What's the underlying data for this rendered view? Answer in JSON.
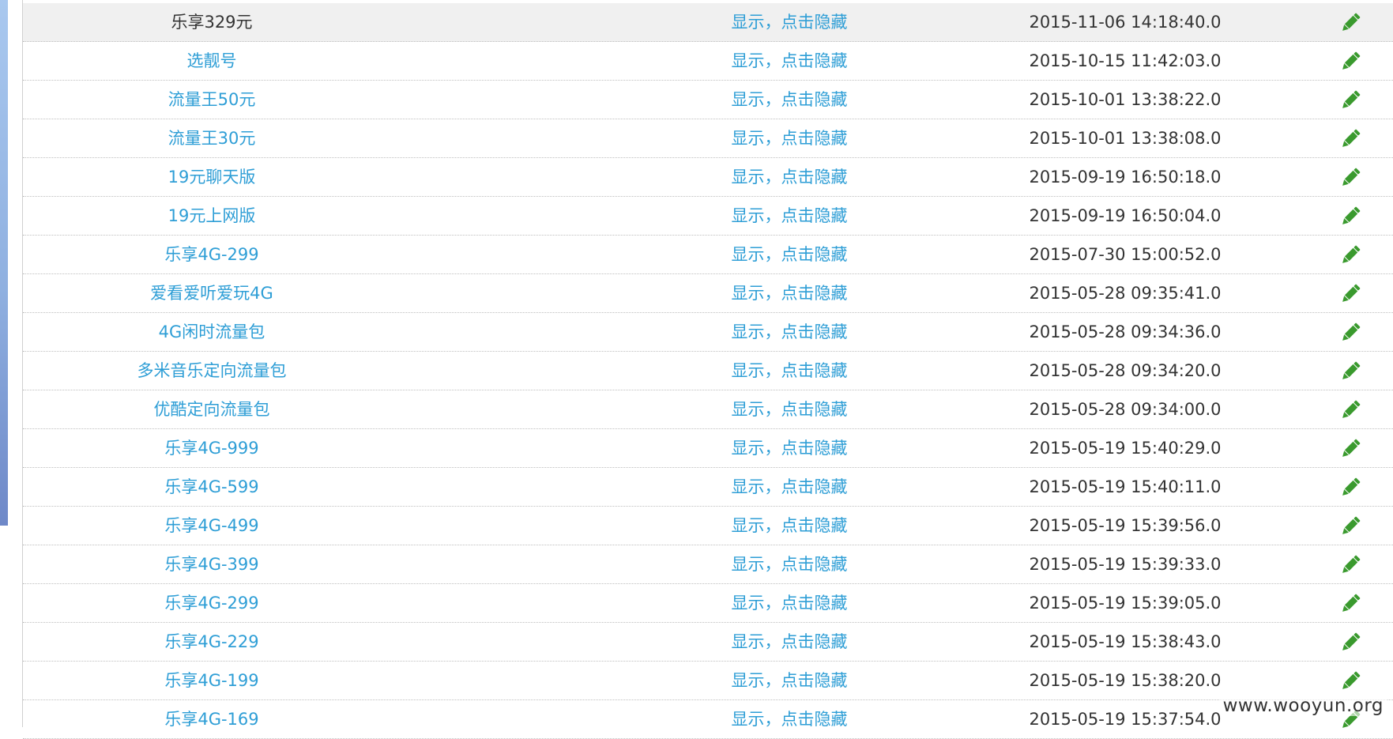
{
  "rows": [
    {
      "name": "乐享329元",
      "status": "显示，点击隐藏",
      "time": "2015-11-06 14:18:40.0",
      "highlight": true
    },
    {
      "name": "选靓号",
      "status": "显示，点击隐藏",
      "time": "2015-10-15 11:42:03.0"
    },
    {
      "name": "流量王50元",
      "status": "显示，点击隐藏",
      "time": "2015-10-01 13:38:22.0"
    },
    {
      "name": "流量王30元",
      "status": "显示，点击隐藏",
      "time": "2015-10-01 13:38:08.0"
    },
    {
      "name": "19元聊天版",
      "status": "显示，点击隐藏",
      "time": "2015-09-19 16:50:18.0"
    },
    {
      "name": "19元上网版",
      "status": "显示，点击隐藏",
      "time": "2015-09-19 16:50:04.0"
    },
    {
      "name": "乐享4G-299",
      "status": "显示，点击隐藏",
      "time": "2015-07-30 15:00:52.0"
    },
    {
      "name": "爱看爱听爱玩4G",
      "status": "显示，点击隐藏",
      "time": "2015-05-28 09:35:41.0"
    },
    {
      "name": "4G闲时流量包",
      "status": "显示，点击隐藏",
      "time": "2015-05-28 09:34:36.0"
    },
    {
      "name": "多米音乐定向流量包",
      "status": "显示，点击隐藏",
      "time": "2015-05-28 09:34:20.0"
    },
    {
      "name": "优酷定向流量包",
      "status": "显示，点击隐藏",
      "time": "2015-05-28 09:34:00.0"
    },
    {
      "name": "乐享4G-999",
      "status": "显示，点击隐藏",
      "time": "2015-05-19 15:40:29.0"
    },
    {
      "name": "乐享4G-599",
      "status": "显示，点击隐藏",
      "time": "2015-05-19 15:40:11.0"
    },
    {
      "name": "乐享4G-499",
      "status": "显示，点击隐藏",
      "time": "2015-05-19 15:39:56.0"
    },
    {
      "name": "乐享4G-399",
      "status": "显示，点击隐藏",
      "time": "2015-05-19 15:39:33.0"
    },
    {
      "name": "乐享4G-299",
      "status": "显示，点击隐藏",
      "time": "2015-05-19 15:39:05.0"
    },
    {
      "name": "乐享4G-229",
      "status": "显示，点击隐藏",
      "time": "2015-05-19 15:38:43.0"
    },
    {
      "name": "乐享4G-199",
      "status": "显示，点击隐藏",
      "time": "2015-05-19 15:38:20.0"
    },
    {
      "name": "乐享4G-169",
      "status": "显示，点击隐藏",
      "time": "2015-05-19 15:37:54.0"
    }
  ],
  "edit_icon": "pencil-icon",
  "watermark": "www.wooyun.org",
  "colors": {
    "link": "#2e9ed6",
    "text": "#333333",
    "pencil": "#3a9a2e",
    "highlight_row": "#f0f0f0"
  }
}
